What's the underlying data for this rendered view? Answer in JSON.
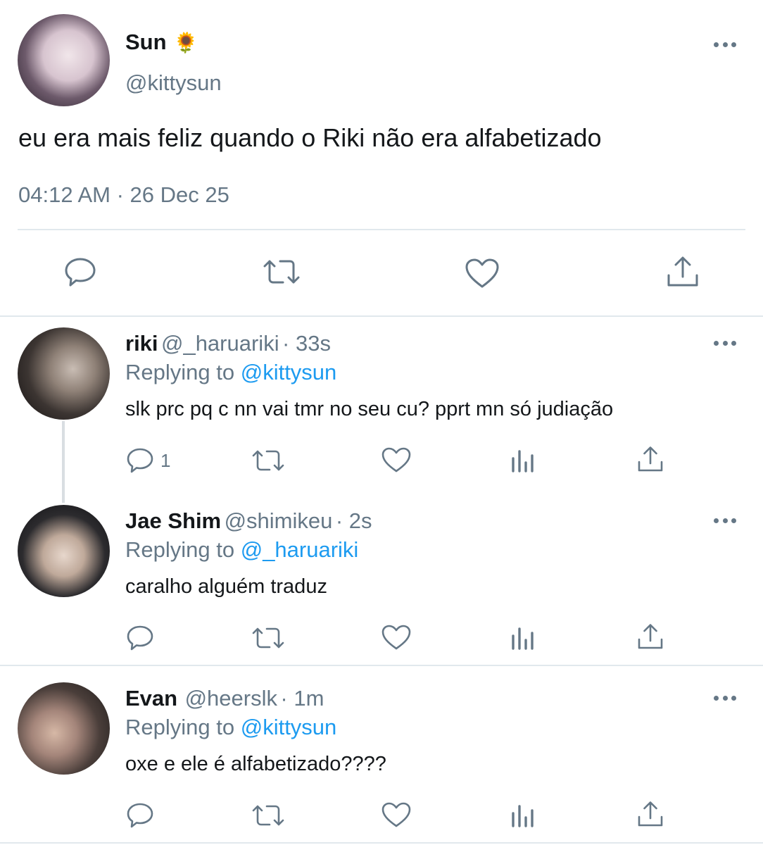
{
  "main_tweet": {
    "author_name": "Sun",
    "author_emoji": "🌻",
    "handle": "@kittysun",
    "text": "eu era mais feliz quando o Riki não era alfabetizado",
    "timestamp": "04:12 AM · 26 Dec 25"
  },
  "replies": [
    {
      "author_name": "riki",
      "handle": "@_haruariki",
      "time": "· 33s",
      "replying_prefix": "Replying to",
      "replying_to": "@kittysun",
      "text": "slk prc pq c nn vai tmr no seu cu? pprt mn só judiação",
      "reply_count": "1"
    },
    {
      "author_name": "Jae Shim",
      "handle": "@shimikeu",
      "time": "· 2s",
      "replying_prefix": "Replying to",
      "replying_to": "@_haruariki",
      "text": "caralho alguém traduz",
      "reply_count": ""
    },
    {
      "author_name": "Evan",
      "handle": "@heerslk",
      "time": "· 1m",
      "replying_prefix": "Replying to",
      "replying_to": "@kittysun",
      "text": "oxe e ele é alfabetizado????",
      "reply_count": ""
    }
  ],
  "colors": {
    "link": "#1d9bf0",
    "muted": "#657786",
    "divider": "#e1e8ed"
  },
  "icons": [
    "reply-icon",
    "retweet-icon",
    "like-icon",
    "share-icon",
    "analytics-icon",
    "more-icon"
  ]
}
